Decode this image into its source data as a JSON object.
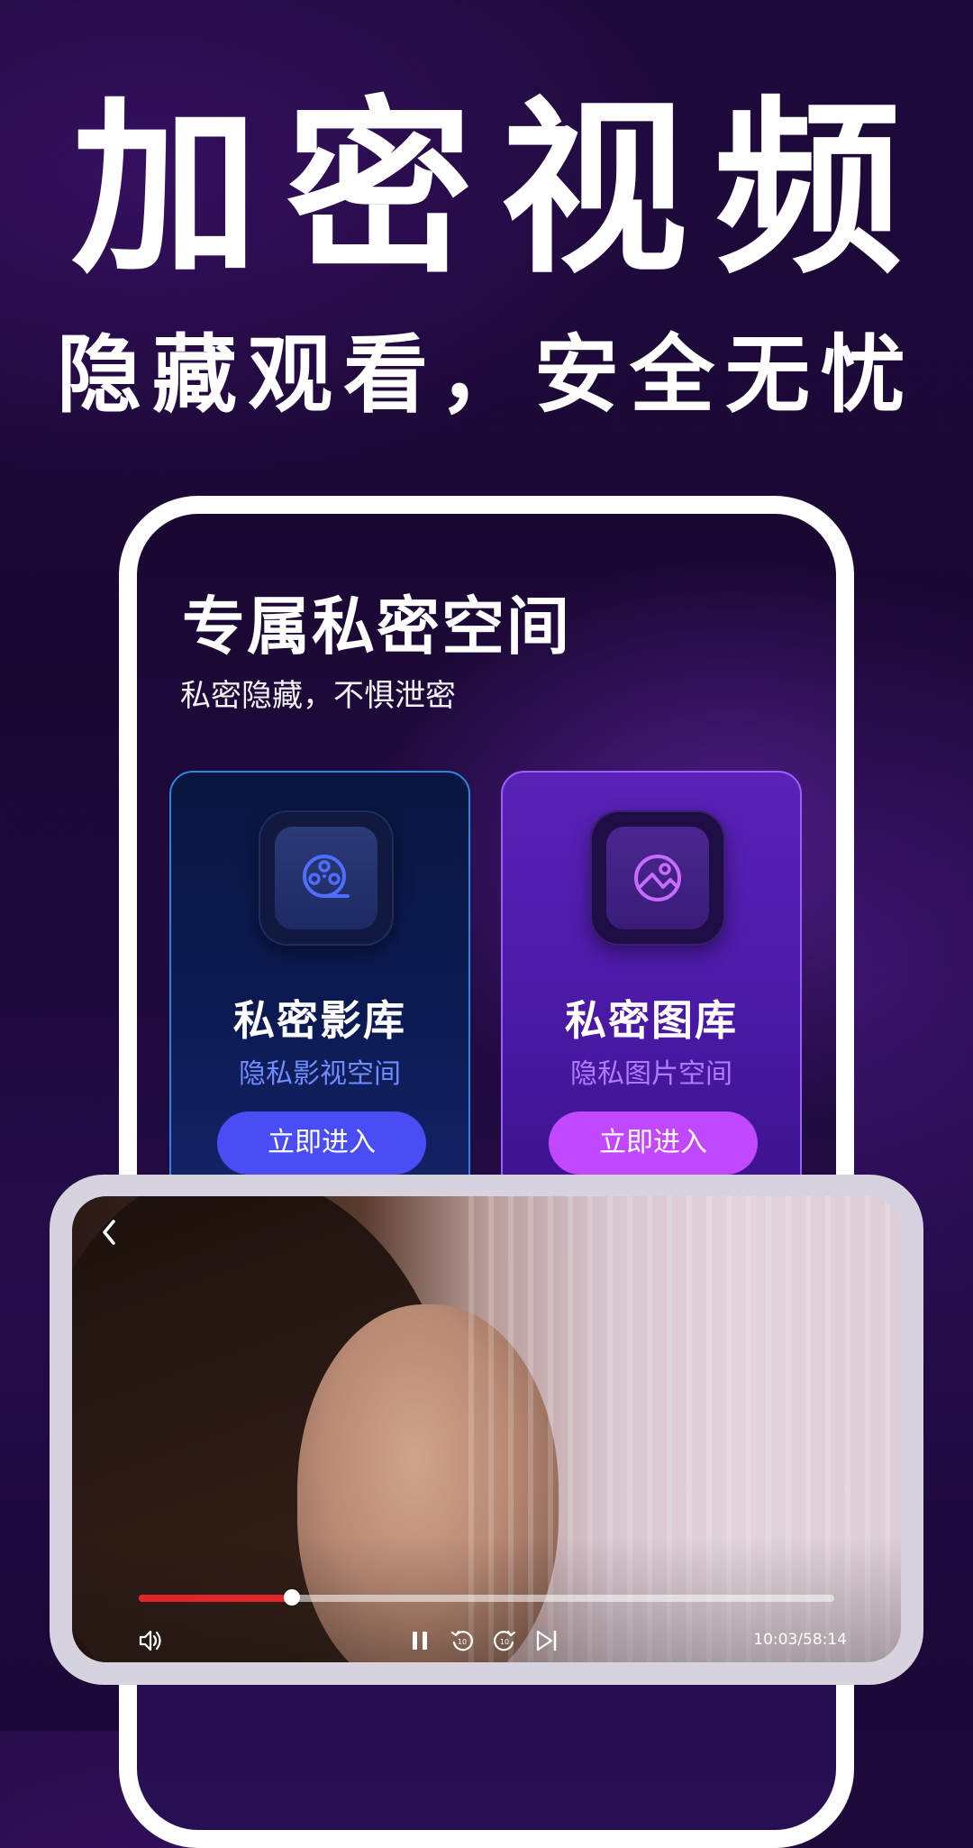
{
  "hero": {
    "headline": "加密视频",
    "subline": "隐藏观看，安全无忧"
  },
  "phone": {
    "space_title": "专属私密空间",
    "space_subtitle": "私密隐藏，不惧泄密",
    "cards": [
      {
        "title": "私密影库",
        "subtitle": "隐私影视空间",
        "button": "立即进入",
        "icon": "film-reel-icon",
        "accent": "#4a4cf4"
      },
      {
        "title": "私密图库",
        "subtitle": "隐私图片空间",
        "button": "立即进入",
        "icon": "image-icon",
        "accent": "#c148ff"
      }
    ]
  },
  "player": {
    "back_icon": "chevron-left-icon",
    "progress": 0.22,
    "time": "10:03/58:14",
    "controls": [
      "volume-icon",
      "pause-icon",
      "rewind-10-icon",
      "forward-10-icon",
      "skip-next-icon"
    ],
    "progress_color": "#e0262a"
  }
}
